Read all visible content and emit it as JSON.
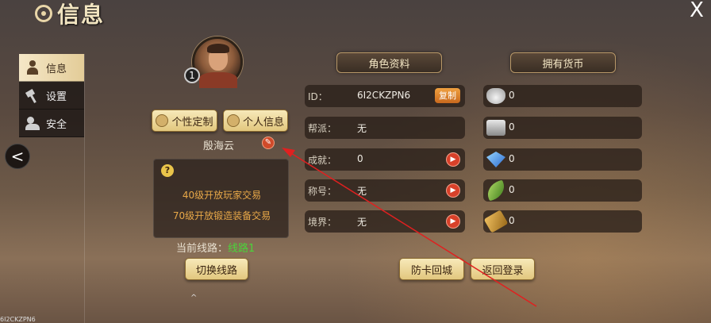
{
  "header": {
    "title": "信息",
    "close_label": "X"
  },
  "sidebar": {
    "items": [
      {
        "label": "信息",
        "icon": "person-icon",
        "active": true
      },
      {
        "label": "设置",
        "icon": "hammer-icon",
        "active": false
      },
      {
        "label": "安全",
        "icon": "shield-icon",
        "active": false
      }
    ],
    "back_label": "<"
  },
  "profile": {
    "level": "1",
    "customize_label": "个性定制",
    "personal_info_label": "个人信息",
    "name": "殷海云",
    "notes": [
      "40级开放玩家交易",
      "70级开放锻造装备交易"
    ],
    "route_label": "当前线路：",
    "route_value": "线路1",
    "switch_route_label": "切换线路"
  },
  "character": {
    "header": "角色资料",
    "rows": [
      {
        "label": "ID：",
        "value": "6I2CKZPN6",
        "action": "复制"
      },
      {
        "label": "帮派：",
        "value": "无"
      },
      {
        "label": "成就：",
        "value": "0",
        "action": "go"
      },
      {
        "label": "称号：",
        "value": "无",
        "action": "go"
      },
      {
        "label": "境界：",
        "value": "无",
        "action": "go"
      }
    ],
    "anti_stuck_label": "防卡回城",
    "back_login_label": "返回登录"
  },
  "currency": {
    "header": "拥有货币",
    "items": [
      {
        "icon": "silver-ingot-icon",
        "value": "0"
      },
      {
        "icon": "bound-silver-icon",
        "value": "0"
      },
      {
        "icon": "diamond-icon",
        "value": "0"
      },
      {
        "icon": "jade-leaf-icon",
        "value": "0"
      },
      {
        "icon": "scroll-icon",
        "value": "0"
      }
    ]
  },
  "footer": {
    "id_text": "6I2CKZPN6"
  },
  "colors": {
    "accent_gold": "#e2c77e",
    "route_green": "#4ad43a",
    "note_orange": "#e8a848",
    "annotation_red": "#e02020"
  }
}
